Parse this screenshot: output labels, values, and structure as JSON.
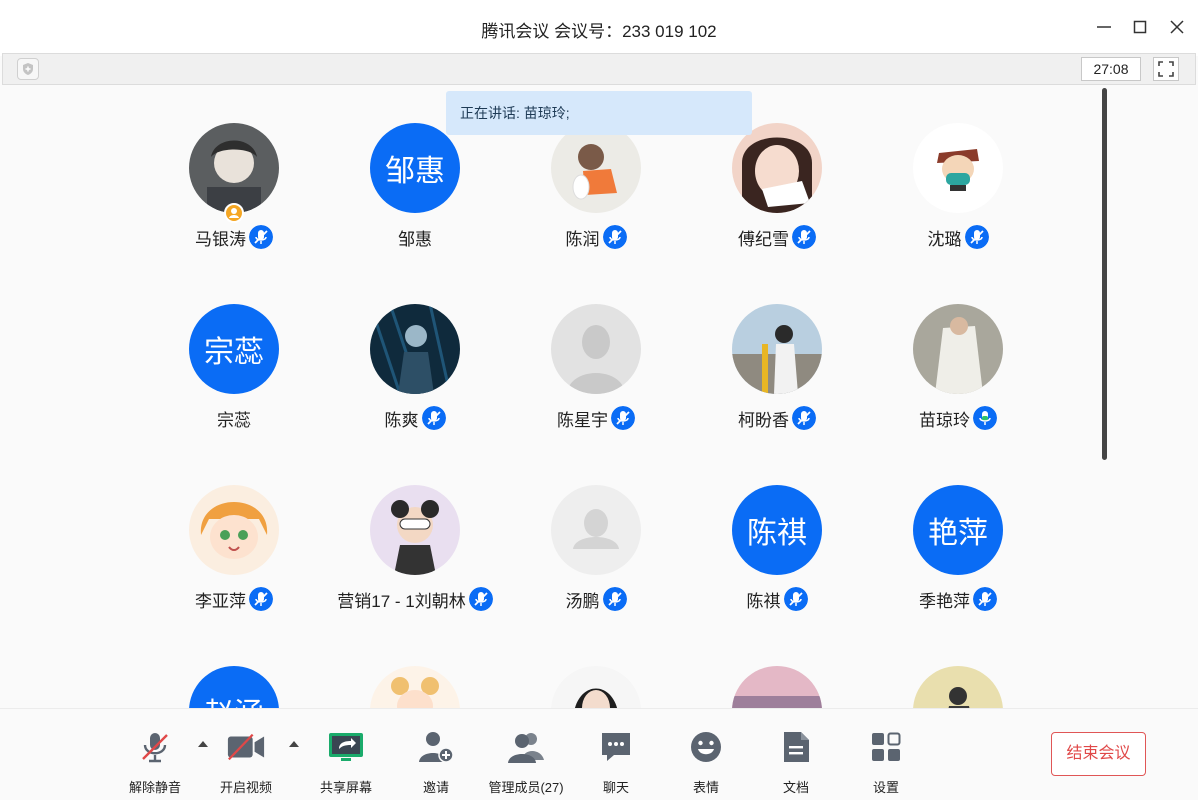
{
  "window": {
    "title": "腾讯会议 会议号：233 019 102"
  },
  "infobar": {
    "timer": "27:08"
  },
  "speaking": {
    "text": "正在讲话: 苗琼玲;"
  },
  "participants": [
    {
      "name": "马银涛",
      "avatar": "photo",
      "mic": "muted",
      "host": true
    },
    {
      "name": "邹惠",
      "avatar_text": "邹惠",
      "mic": "none"
    },
    {
      "name": "陈润",
      "avatar": "photo",
      "mic": "muted"
    },
    {
      "name": "傅纪雪",
      "avatar": "photo",
      "mic": "muted"
    },
    {
      "name": "沈璐",
      "avatar": "photo",
      "mic": "muted"
    },
    {
      "name": "宗蕊",
      "avatar_text": "宗蕊",
      "mic": "none"
    },
    {
      "name": "陈爽",
      "avatar": "photo",
      "mic": "muted"
    },
    {
      "name": "陈星宇",
      "avatar": "default",
      "mic": "muted"
    },
    {
      "name": "柯盼香",
      "avatar": "photo",
      "mic": "muted"
    },
    {
      "name": "苗琼玲",
      "avatar": "photo",
      "mic": "active"
    },
    {
      "name": "李亚萍",
      "avatar": "photo",
      "mic": "muted"
    },
    {
      "name": "营销17 - 1刘朝林",
      "avatar": "photo",
      "mic": "muted"
    },
    {
      "name": "汤鹏",
      "avatar": "default-light",
      "mic": "muted"
    },
    {
      "name": "陈祺",
      "avatar_text": "陈祺",
      "mic": "muted"
    },
    {
      "name": "季艳萍",
      "avatar_text": "艳萍",
      "mic": "muted"
    },
    {
      "name": "",
      "avatar_text": "赵涵",
      "mic": "none"
    },
    {
      "name": "",
      "avatar": "photo",
      "mic": "none"
    },
    {
      "name": "",
      "avatar": "photo",
      "mic": "none"
    },
    {
      "name": "",
      "avatar": "photo",
      "mic": "none"
    },
    {
      "name": "",
      "avatar": "photo",
      "mic": "none"
    }
  ],
  "toolbar": {
    "unmute": "解除静音",
    "start_video": "开启视频",
    "share_screen": "共享屏幕",
    "invite": "邀请",
    "manage_members": "管理成员(27)",
    "chat": "聊天",
    "reactions": "表情",
    "docs": "文档",
    "settings": "设置",
    "end_meeting": "结束会议"
  },
  "colors": {
    "accent": "#0a6cf5",
    "active_mic": "#2ec26b",
    "end": "#e04848",
    "share_green": "#1aab6b"
  }
}
